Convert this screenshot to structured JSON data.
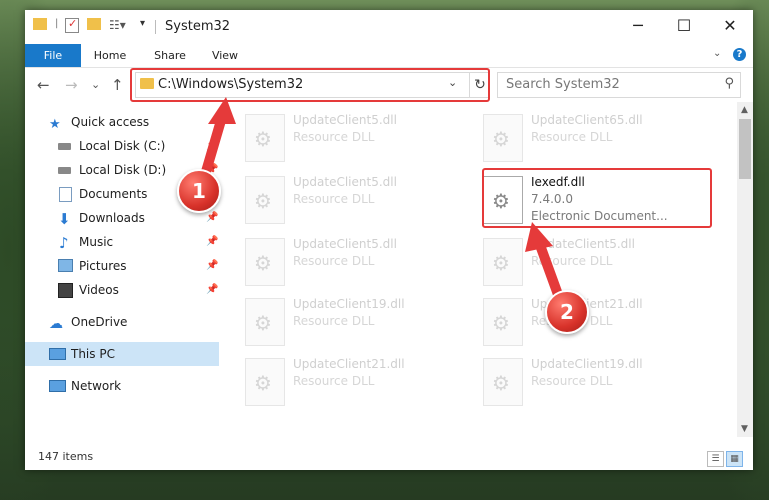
{
  "window": {
    "title": "System32",
    "controls": {
      "minimize": "─",
      "maximize": "☐",
      "close": "✕"
    }
  },
  "ribbon": {
    "tabs": [
      "File",
      "Home",
      "Share",
      "View"
    ],
    "help": "?",
    "expand": "⌄"
  },
  "address_bar": {
    "path": "C:\\Windows\\System32",
    "dropdown": "⌄",
    "refresh": "↻"
  },
  "search": {
    "placeholder": "Search System32",
    "icon": "search-icon"
  },
  "nav": {
    "back": "←",
    "forward": "→",
    "recent": "⌄",
    "up": "↑",
    "items": [
      {
        "label": "Quick access",
        "icon": "star-icon",
        "pinned": false
      },
      {
        "label": "Local Disk (C:)",
        "icon": "drive-icon",
        "pinned": true
      },
      {
        "label": "Local Disk (D:)",
        "icon": "drive-icon",
        "pinned": true
      },
      {
        "label": "Documents",
        "icon": "documents-icon",
        "pinned": true
      },
      {
        "label": "Downloads",
        "icon": "download-icon",
        "pinned": true
      },
      {
        "label": "Music",
        "icon": "music-icon",
        "pinned": true
      },
      {
        "label": "Pictures",
        "icon": "pictures-icon",
        "pinned": true
      },
      {
        "label": "Videos",
        "icon": "videos-icon",
        "pinned": true
      },
      {
        "label": "OneDrive",
        "icon": "cloud-icon",
        "pinned": false
      },
      {
        "label": "This PC",
        "icon": "computer-icon",
        "pinned": false,
        "selected": true
      },
      {
        "label": "Network",
        "icon": "network-icon",
        "pinned": false
      }
    ]
  },
  "files": [
    {
      "name": "UpdateClient5.dll",
      "type": "Resource DLL"
    },
    {
      "name": "UpdateClient65.dll",
      "type": "Resource DLL"
    },
    {
      "name": "UpdateClient5.dll",
      "type": "Resource DLL"
    },
    {
      "name": "Iexedf.dll",
      "version": "7.4.0.0",
      "type": "Electronic Document...",
      "highlighted": true
    },
    {
      "name": "UpdateClient5.dll",
      "type": "Resource DLL"
    },
    {
      "name": "UpdateClient5.dll",
      "type": "Resource DLL"
    },
    {
      "name": "UpdateClient19.dll",
      "type": "Resource DLL"
    },
    {
      "name": "UpdateClient21.dll",
      "type": "Resource DLL"
    },
    {
      "name": "UpdateClient21.dll",
      "type": "Resource DLL"
    },
    {
      "name": "UpdateClient19.dll",
      "type": "Resource DLL"
    }
  ],
  "status": {
    "item_count": "147 items"
  },
  "annotations": {
    "step1": "1",
    "step2": "2",
    "color": "#e53a3a"
  },
  "colors": {
    "accent": "#1979ca",
    "selected": "#cce4f7",
    "folder": "#f0c04a"
  }
}
